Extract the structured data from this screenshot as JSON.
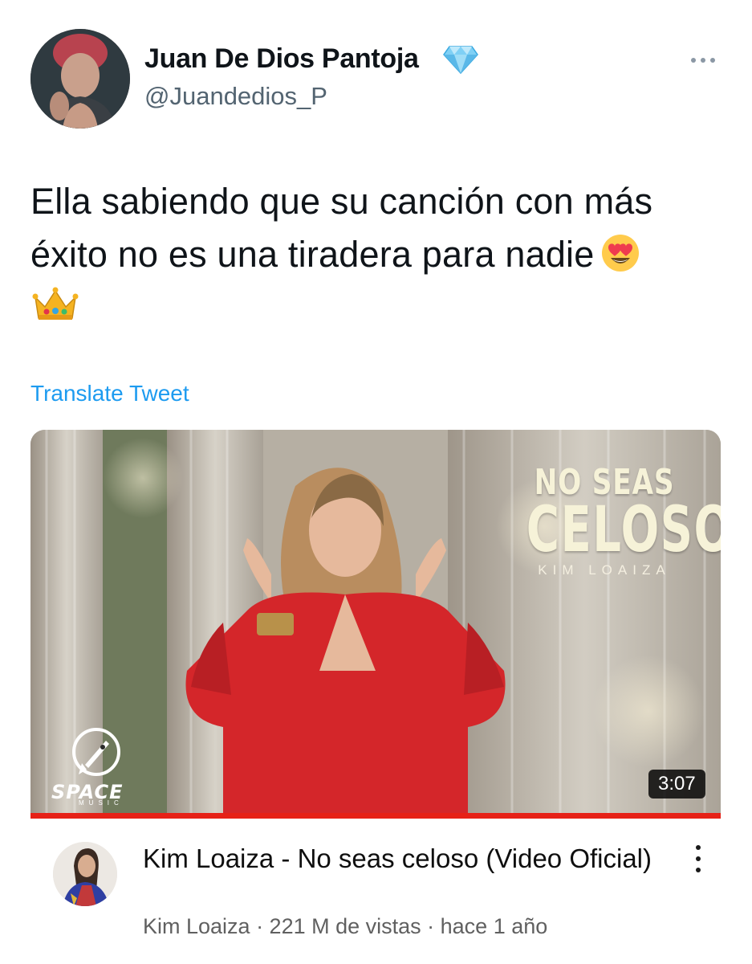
{
  "author": {
    "display_name": "Juan De Dios Pantoja",
    "handle": "@Juandedios_P"
  },
  "tweet": {
    "text_line1": "Ella sabiendo que su canción con más",
    "text_line2": "éxito no es una tiradera para nadie",
    "emojis": [
      "smiling-face-with-heart-eyes",
      "crown"
    ],
    "translate_label": "Translate Tweet"
  },
  "video": {
    "thumbnail_title_line1": "NO SEAS",
    "thumbnail_title_line2": "CELOSO",
    "thumbnail_artist": "KIM LOAIZA",
    "logo_text": "SPACE",
    "logo_subtext": "MUSIC",
    "duration": "3:07",
    "title": "Kim Loaiza - No seas celoso (Video Oficial)",
    "meta": "Kim Loaiza · 221 M de vistas · hace 1 año",
    "progress_color": "#e62117"
  },
  "colors": {
    "link": "#1d9bf0",
    "secondary_text": "#536471"
  }
}
